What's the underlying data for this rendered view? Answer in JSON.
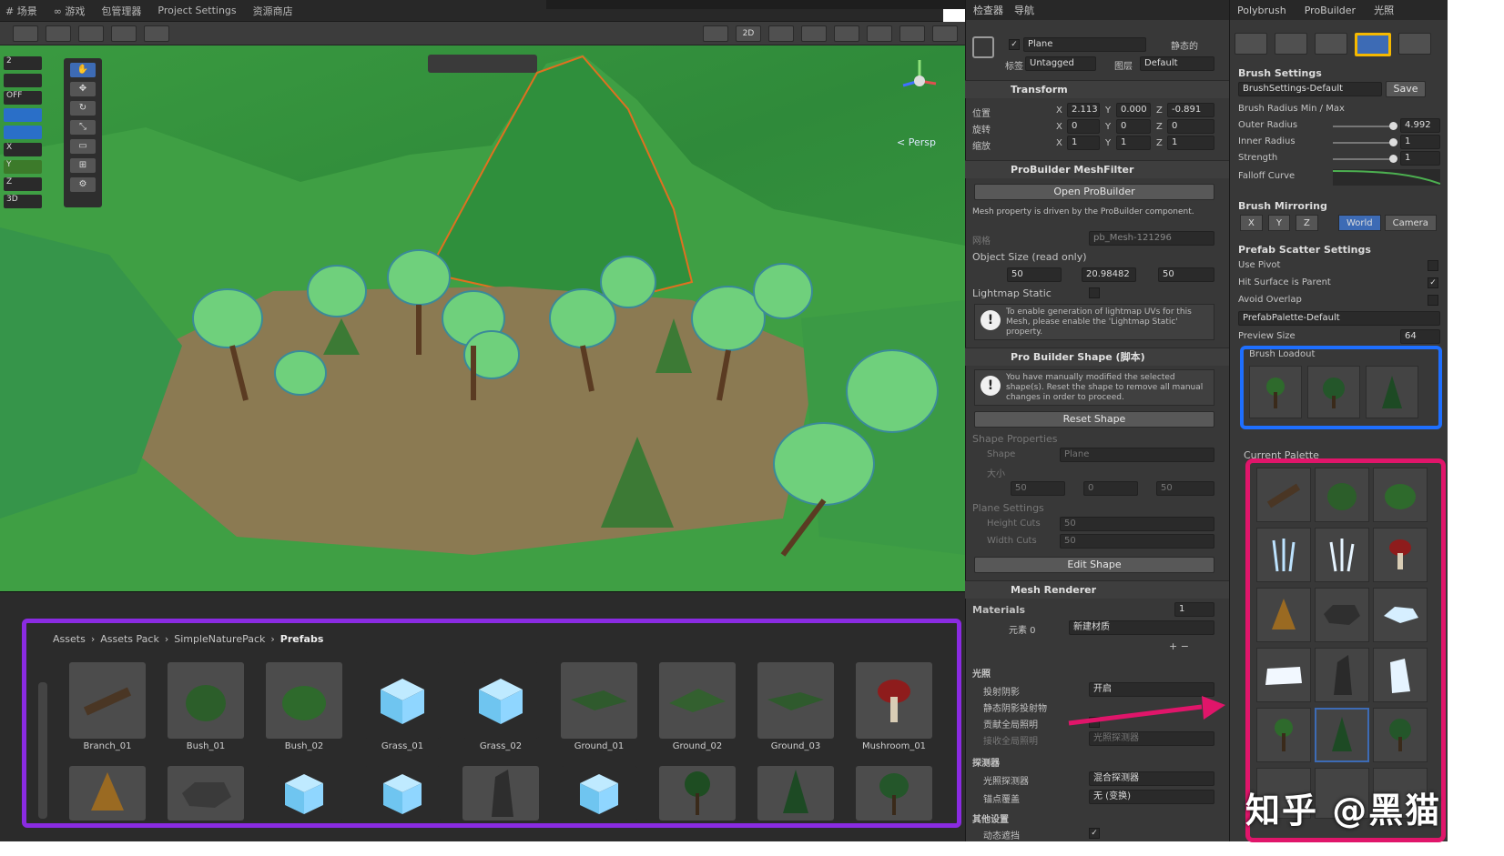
{
  "scene_tabs": [
    "# 场景",
    "∞ 游戏",
    "包管理器",
    "Project Settings",
    "资源商店"
  ],
  "scene_view": {
    "persp_label": "< Persp",
    "mode_2d": "2D"
  },
  "left_strip": [
    "2",
    "",
    "OFF",
    "",
    "",
    "X",
    "Y",
    "Z",
    "3D"
  ],
  "breadcrumb": [
    "Assets",
    "Assets Pack",
    "SimpleNaturePack",
    "Prefabs"
  ],
  "assets_row1": [
    "Branch_01",
    "Bush_01",
    "Bush_02",
    "Grass_01",
    "Grass_02",
    "Ground_01",
    "Ground_02",
    "Ground_03",
    "Mushroom_01"
  ],
  "inspector": {
    "tabs": [
      "检查器",
      "导航"
    ],
    "object_name": "Plane",
    "static_label": "静态的",
    "tag_label": "标签",
    "tag_value": "Untagged",
    "layer_label": "图层",
    "layer_value": "Default",
    "transform": {
      "title": "Transform",
      "pos_label": "位置",
      "rot_label": "旋转",
      "scale_label": "缩放",
      "pos": [
        "2.113",
        "0.000",
        "-0.891"
      ],
      "rot": [
        "0",
        "0",
        "0"
      ],
      "scale": [
        "1",
        "1",
        "1"
      ]
    },
    "meshfilter": {
      "title": "ProBuilder MeshFilter",
      "open_btn": "Open ProBuilder",
      "note": "Mesh property is driven by the ProBuilder component.",
      "mesh_label": "网格",
      "mesh_value": "pb_Mesh-121296",
      "size_label": "Object Size (read only)",
      "size": [
        "50",
        "20.98482",
        "50"
      ],
      "lightmap_label": "Lightmap Static",
      "lightmap_warn": "To enable generation of lightmap UVs for this Mesh, please enable the 'Lightmap Static' property."
    },
    "shape": {
      "title": "Pro Builder Shape (脚本)",
      "warn": "You have manually modified the selected shape(s). Reset the shape to remove all manual changes in order to proceed.",
      "reset_btn": "Reset Shape",
      "props_label": "Shape Properties",
      "shape_label": "Shape",
      "shape_value": "Plane",
      "size_label": "大小",
      "size": [
        "50",
        "0",
        "50"
      ],
      "plane_settings": "Plane Settings",
      "height_cuts_label": "Height Cuts",
      "height_cuts": "50",
      "width_cuts_label": "Width Cuts",
      "width_cuts": "50",
      "edit_btn": "Edit Shape"
    },
    "renderer": {
      "title": "Mesh Renderer",
      "materials_label": "Materials",
      "materials_count": "1",
      "element_label": "元素 0",
      "element_value": "新建材质",
      "lighting_label": "光照",
      "cast_label": "投射阴影",
      "cast_value": "开启",
      "static_shadow_label": "静态阴影投射物",
      "gi_label": "贡献全局照明",
      "receive_gi_label": "接收全局照明",
      "receive_gi_value": "光照探测器",
      "probes_label": "探测器",
      "light_probe_label": "光照探测器",
      "light_probe_value": "混合探测器",
      "anchor_label": "锚点覆盖",
      "anchor_value": "无 (变换)",
      "other_label": "其他设置",
      "motion_label": "动态遮挡"
    }
  },
  "polybrush": {
    "tabs": [
      "Polybrush",
      "ProBuilder",
      "光照"
    ],
    "brush_settings_title": "Brush Settings",
    "brush_preset": "BrushSettings-Default",
    "save_btn": "Save",
    "radius_label": "Brush Radius Min / Max",
    "outer_label": "Outer Radius",
    "outer_value": "4.992",
    "inner_label": "Inner Radius",
    "inner_value": "1",
    "strength_label": "Strength",
    "strength_value": "1",
    "falloff_label": "Falloff Curve",
    "mirroring_title": "Brush Mirroring",
    "axes": [
      "X",
      "Y",
      "Z"
    ],
    "space": [
      "World",
      "Camera"
    ],
    "scatter_title": "Prefab Scatter Settings",
    "use_pivot": "Use Pivot",
    "hit_surface": "Hit Surface is Parent",
    "avoid_overlap": "Avoid Overlap",
    "palette_preset": "PrefabPalette-Default",
    "preview_label": "Preview Size",
    "preview_value": "64",
    "loadout_label": "Brush Loadout",
    "current_palette": "Current Palette"
  },
  "watermark": "知乎 @黑猫",
  "colors": {
    "purple": "#8a2be2",
    "blue": "#1e6fff",
    "pink": "#e0156a",
    "yellow": "#f5b800"
  }
}
